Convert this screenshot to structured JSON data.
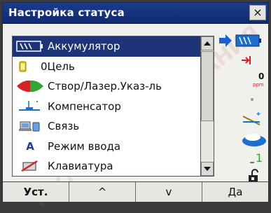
{
  "window": {
    "title": "Настройка статуса",
    "close_label": "×"
  },
  "list": {
    "items": [
      {
        "label": "Аккумулятор",
        "icon": "battery-icon",
        "selected": true
      },
      {
        "label": "Цель",
        "icon": "prism-target-icon",
        "prefix": "0"
      },
      {
        "label": "Створ/Лазер.Указ-ль",
        "icon": "guide-light-laser-icon"
      },
      {
        "label": "Компенсатор",
        "icon": "tilt-compensator-icon"
      },
      {
        "label": "Связь",
        "icon": "communication-icon"
      },
      {
        "label": "Режим ввода",
        "icon": "input-mode-icon",
        "glyph": "A"
      },
      {
        "label": "Клавиатура",
        "icon": "keyboard-icon"
      }
    ]
  },
  "status_icons": [
    "battery-pointer-icon",
    "target-status-icon",
    "ppm-status-icon",
    "laser-status-icon",
    "compensator-status-icon",
    "communication-status-icon",
    "input-mode-status-icon",
    "keyboard-lock-status-icon"
  ],
  "status_text": {
    "ppm_value": "0",
    "ppm_unit": "ppm",
    "input_value": "1"
  },
  "softkeys": [
    "Уст.",
    "^",
    "v",
    "Да"
  ],
  "watermark_text": "ГЕОСТРОЙИЗЫСКАНИЯ",
  "colors": {
    "title_bg": "#0f2c74",
    "selection_bg": "#1d3479",
    "accent_red": "#d4222a",
    "accent_blue": "#1a6fd0"
  }
}
